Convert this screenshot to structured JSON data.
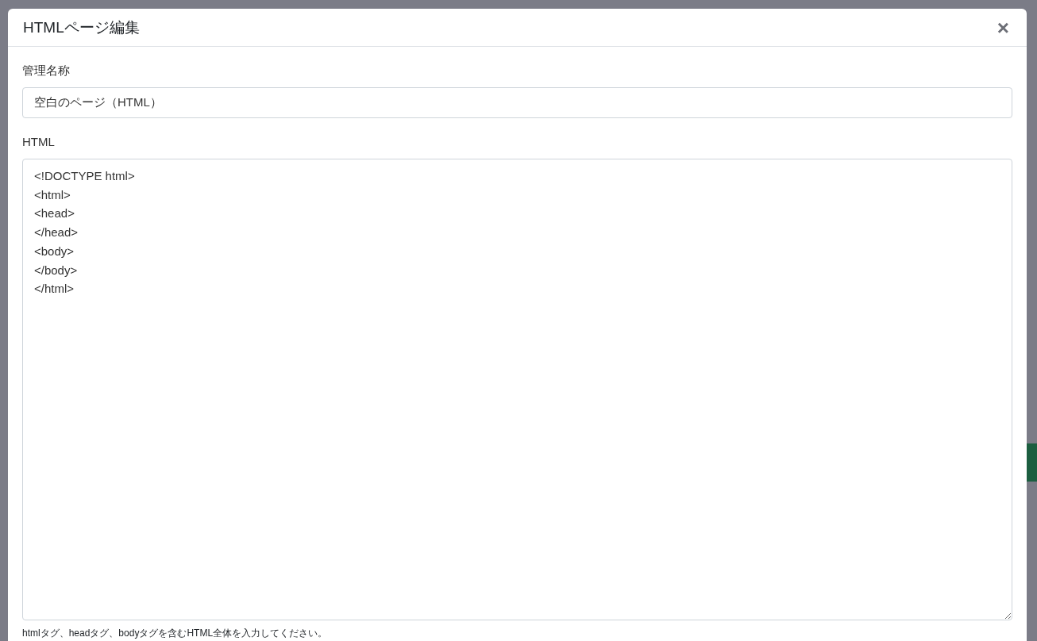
{
  "modal": {
    "title": "HTMLページ編集",
    "close": "×"
  },
  "fields": [
    {
      "kind": "input",
      "label": "管理名称",
      "value": "空白のページ（HTML）"
    },
    {
      "kind": "textarea",
      "label": "HTML",
      "value": "<!DOCTYPE html>\n<html>\n<head>\n</head>\n<body>\n</body>\n</html>",
      "help": "htmlタグ、headタグ、bodyタグを含むHTML全体を入力してください。"
    }
  ]
}
